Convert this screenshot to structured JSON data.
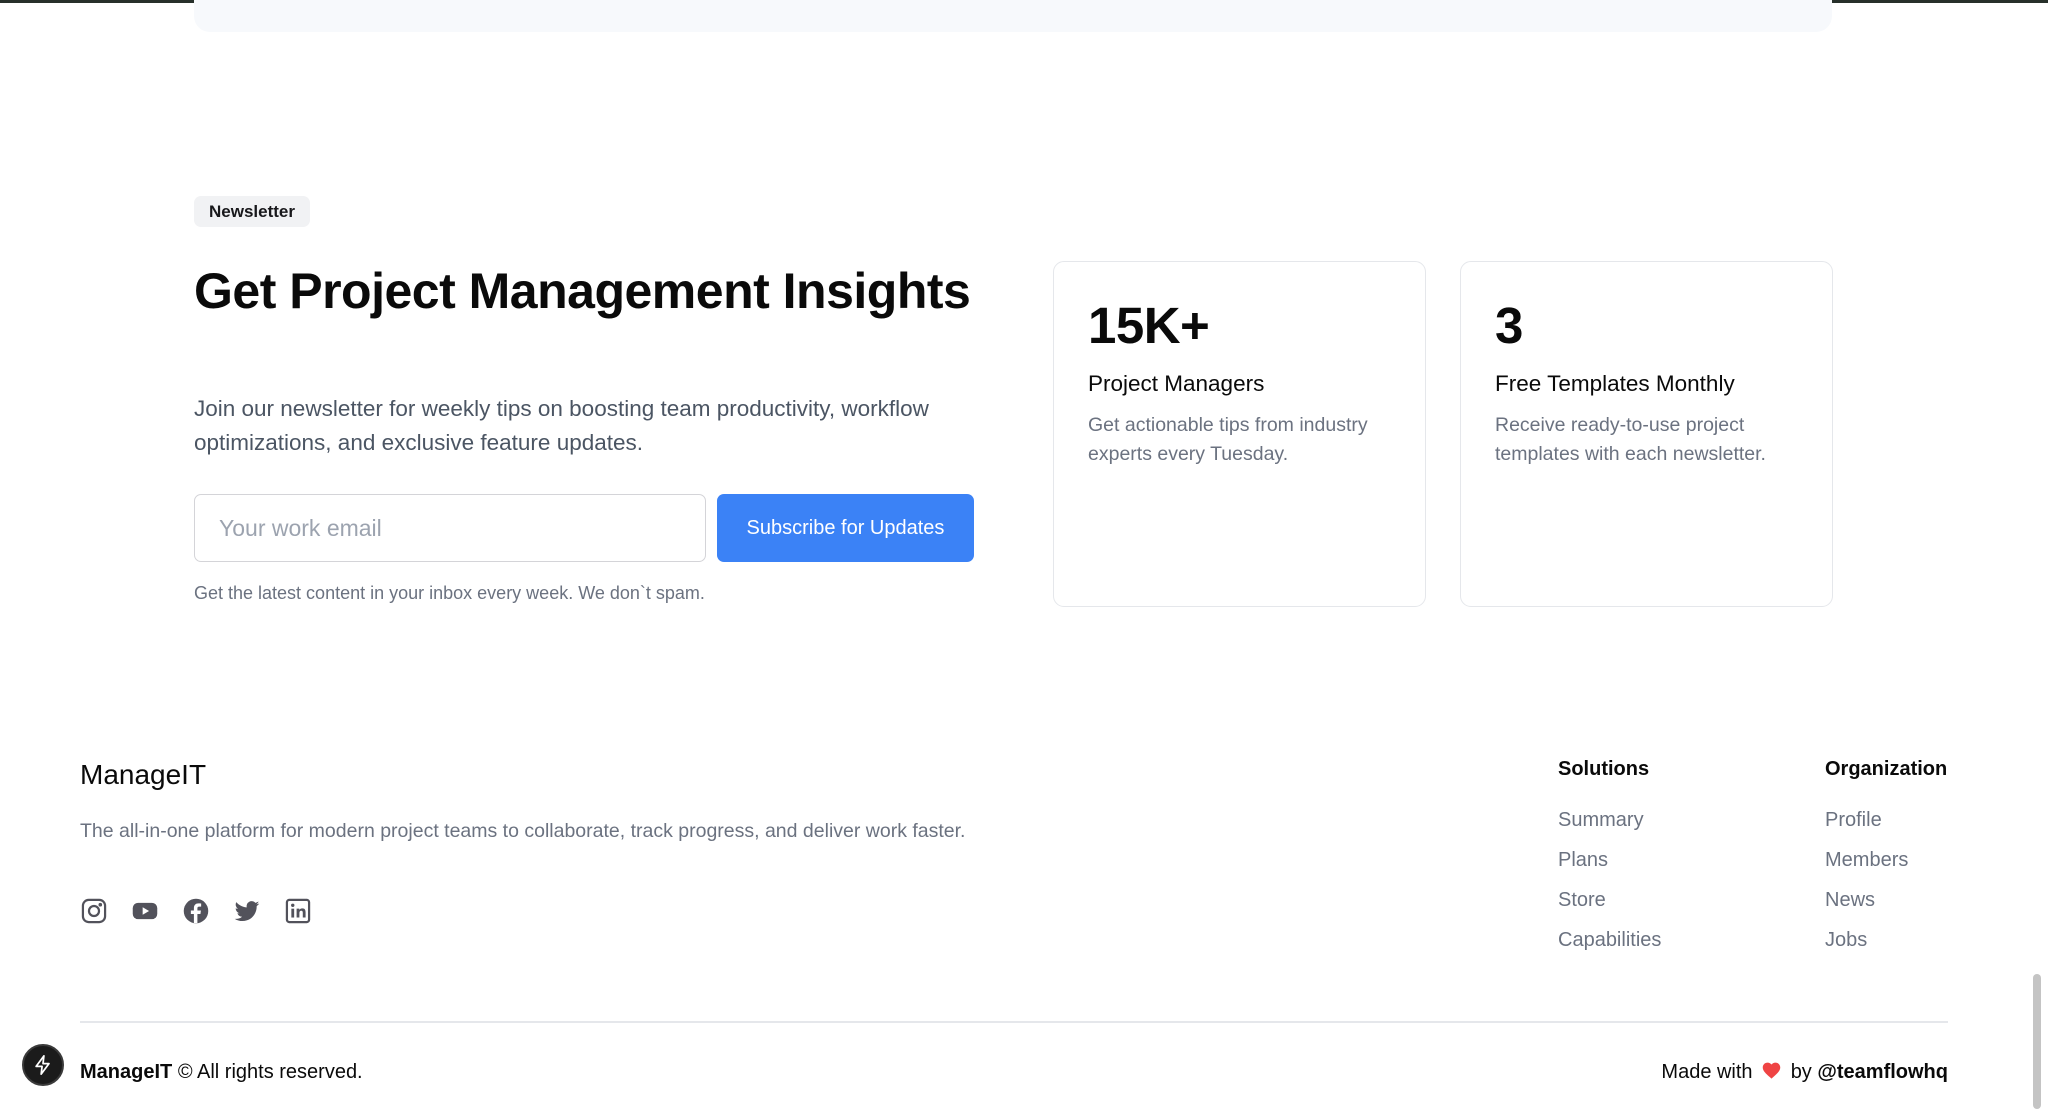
{
  "newsletter": {
    "badge": "Newsletter",
    "headline": "Get Project Management Insights",
    "lead": "Join our newsletter for weekly tips on boosting team productivity, workflow optimizations, and exclusive feature updates.",
    "email_placeholder": "Your work email",
    "email_value": "",
    "subscribe_label": "Subscribe for Updates",
    "hint": "Get the latest content in your inbox every week. We don`t spam."
  },
  "stats": [
    {
      "value": "15K+",
      "title": "Project Managers",
      "description": "Get actionable tips from industry experts every Tuesday."
    },
    {
      "value": "3",
      "title": "Free Templates Monthly",
      "description": "Receive ready-to-use project templates with each newsletter."
    }
  ],
  "footer": {
    "brand": "ManageIT",
    "tagline": "The all-in-one platform for modern project teams to collaborate, track progress, and deliver work faster.",
    "social_icons": [
      "instagram-icon",
      "youtube-icon",
      "facebook-icon",
      "twitter-icon",
      "linkedin-icon"
    ],
    "columns": [
      {
        "title": "Solutions",
        "links": [
          "Summary",
          "Plans",
          "Store",
          "Capabilities"
        ]
      },
      {
        "title": "Organization",
        "links": [
          "Profile",
          "Members",
          "News",
          "Jobs"
        ]
      }
    ],
    "copyright_brand": "ManageIT",
    "copyright_text": "© All rights reserved.",
    "made_with_prefix": "Made with",
    "made_with_by": "by",
    "made_with_handle": "@teamflowhq"
  },
  "colors": {
    "accent": "#3b82f6",
    "heart": "#ef4444",
    "muted_text": "#6b7280"
  }
}
